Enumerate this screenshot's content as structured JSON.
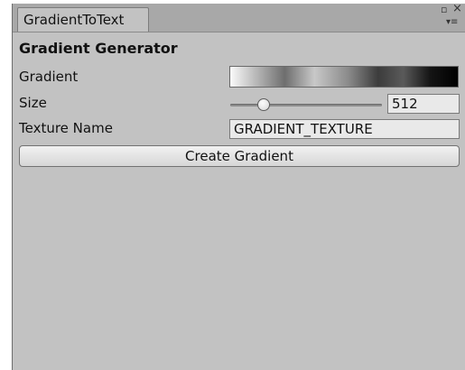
{
  "window": {
    "tab_label": "GradientToText",
    "maximize_icon": "▫",
    "close_icon": "×",
    "menu_icon": "▾≡"
  },
  "inspector": {
    "section_title": "Gradient Generator",
    "gradient_label": "Gradient",
    "size_label": "Size",
    "size_value": "512",
    "size_slider_fraction": 0.22,
    "texture_name_label": "Texture Name",
    "texture_name_value": "GRADIENT_TEXTURE",
    "create_button_label": "Create Gradient"
  }
}
